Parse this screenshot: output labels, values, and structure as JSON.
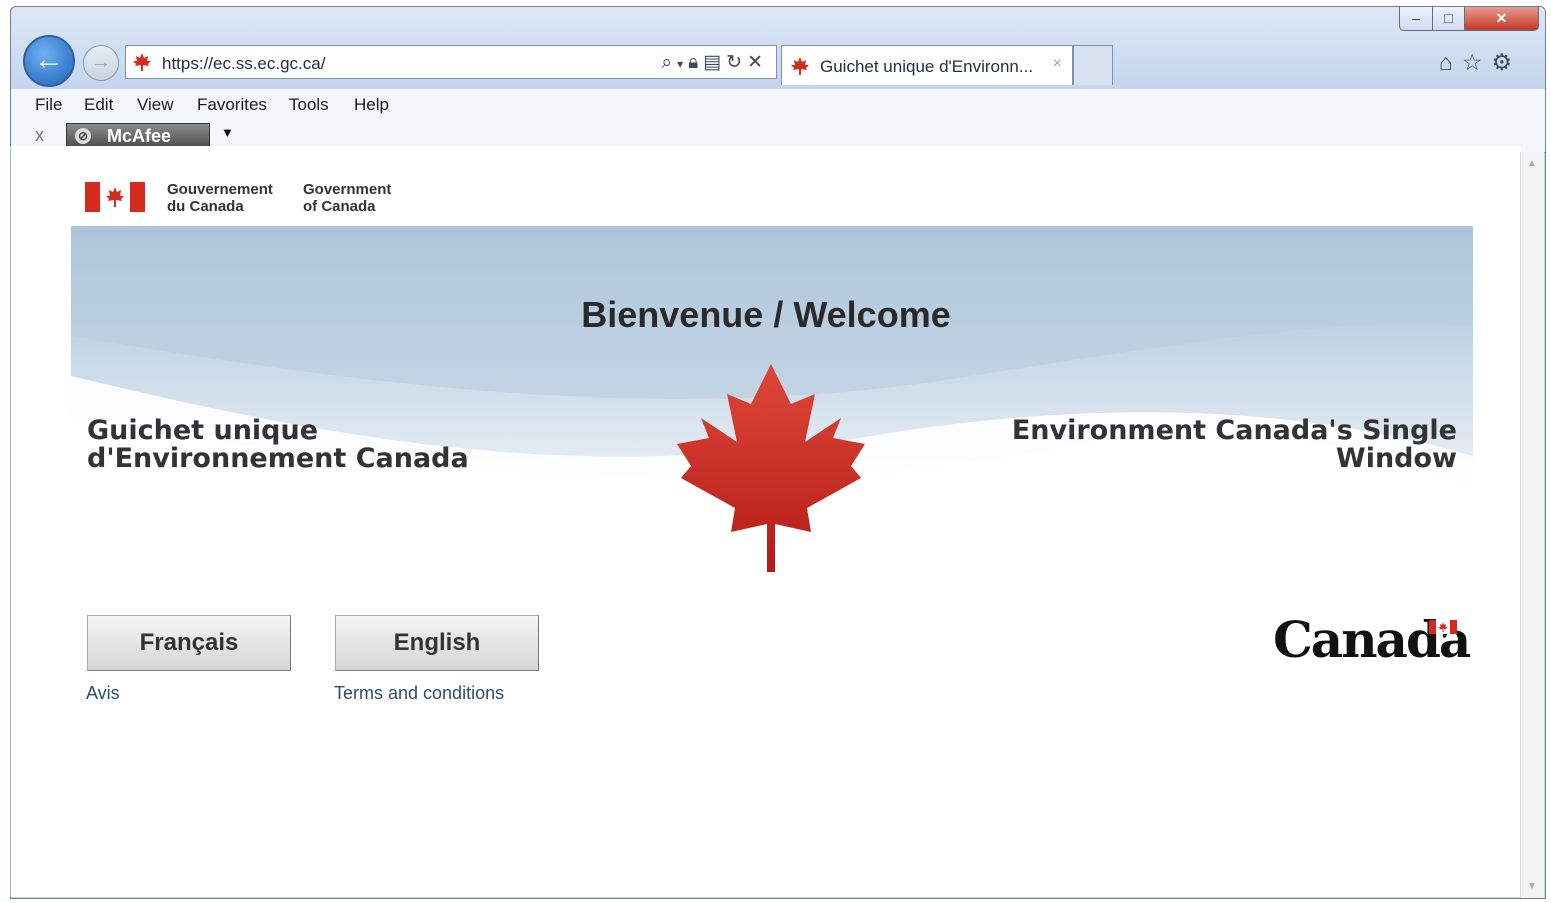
{
  "browser": {
    "url": "https://ec.ss.ec.gc.ca/",
    "tab_title": "Guichet unique d'Environn...",
    "tab_close": "×",
    "window_controls": {
      "minimize": "–",
      "maximize": "□",
      "close": "✕"
    },
    "address_icons": [
      "search-icon",
      "dropdown-icon",
      "lock-icon",
      "compatibility-icon",
      "refresh-icon",
      "stop-icon"
    ],
    "right_icons": [
      "home-icon",
      "star-icon",
      "gear-icon"
    ]
  },
  "menu": {
    "items": [
      "File",
      "Edit",
      "View",
      "Favorites",
      "Tools",
      "Help"
    ]
  },
  "toolbar": {
    "close_label": "x",
    "mcafee_label": "McAfee"
  },
  "page": {
    "goc_fr_line1": "Gouvernement",
    "goc_fr_line2": "du Canada",
    "goc_en_line1": "Government",
    "goc_en_line2": "of Canada",
    "welcome": "Bienvenue / Welcome",
    "title_fr_line1": "Guichet unique",
    "title_fr_line2": "d'Environnement Canada",
    "title_en_line1": "Environment Canada's Single",
    "title_en_line2": "Window",
    "btn_francais": "Français",
    "btn_english": "English",
    "link_avis": "Avis",
    "link_terms": "Terms and conditions",
    "wordmark": "Canada"
  },
  "colors": {
    "canada_red": "#d52b1e",
    "banner_blue": "#a9c4dc",
    "link": "#2c4d6e"
  }
}
